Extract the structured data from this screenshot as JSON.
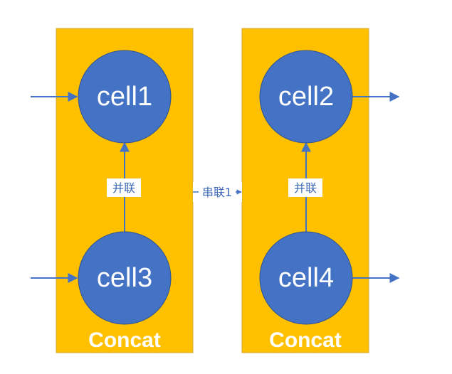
{
  "colors": {
    "panel_fill": "#ffc000",
    "panel_stroke": "#d4a73a",
    "node_fill": "#4472c4",
    "node_stroke": "#2f528f",
    "arrow": "#4472c4",
    "text_light": "#ffffff",
    "edge_label_text": "#3f6ab8"
  },
  "panels": [
    {
      "label": "Concat"
    },
    {
      "label": "Concat"
    }
  ],
  "nodes": [
    {
      "id": "cell1",
      "label": "cell1"
    },
    {
      "id": "cell2",
      "label": "cell2"
    },
    {
      "id": "cell3",
      "label": "cell3"
    },
    {
      "id": "cell4",
      "label": "cell4"
    }
  ],
  "edges": [
    {
      "from": "cell3",
      "to": "cell1",
      "label": "并联"
    },
    {
      "from": "cell4",
      "to": "cell2",
      "label": "并联"
    },
    {
      "from": "panel-left",
      "to": "panel-right",
      "label": "串联1"
    }
  ]
}
